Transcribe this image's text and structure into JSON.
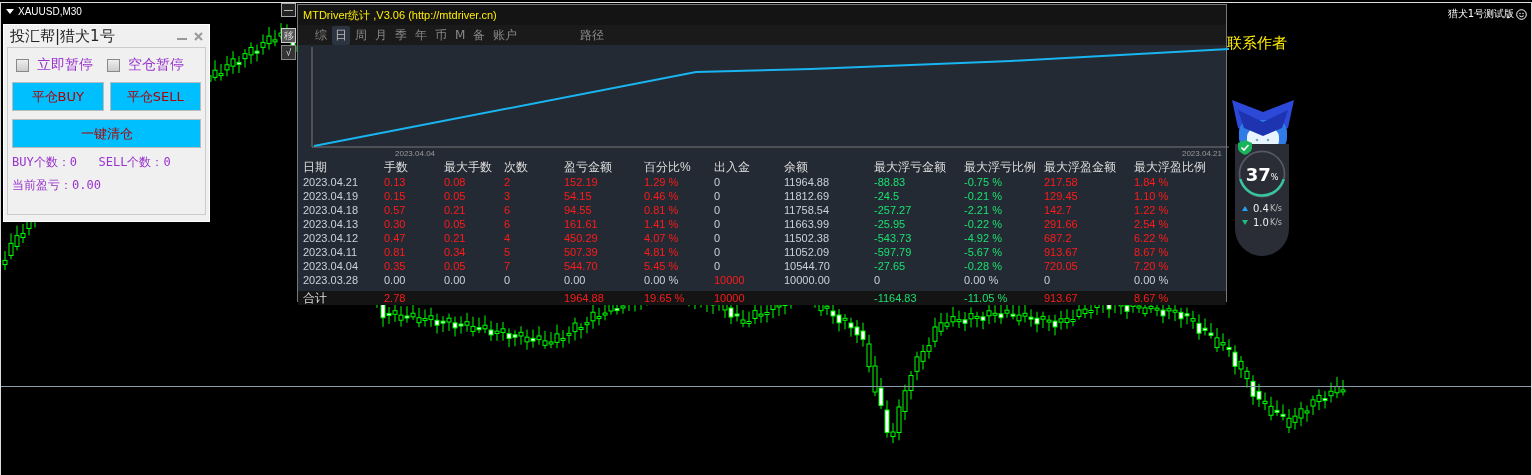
{
  "chart_window": {
    "symbol": "XAUUSD,M30",
    "edition": "猎犬1号测试版",
    "contact": "联系作者",
    "side_buttons": [
      "移",
      "√"
    ],
    "minimize": "—"
  },
  "panel": {
    "title": "投汇帮|猎犬1号",
    "checkboxes": [
      {
        "label": "立即暂停",
        "checked": false
      },
      {
        "label": "空仓暂停",
        "checked": false
      }
    ],
    "buttons": [
      "平仓BUY",
      "平仓SELL"
    ],
    "wide_button": "一键清仓",
    "counts": "BUY个数：0   SELL个数：0",
    "profit": "当前盈亏：0.00"
  },
  "stats": {
    "title": "MTDriver统计 ,V3.06 (http://mtdriver.cn)",
    "tabs": [
      {
        "label": "综",
        "selected": false
      },
      {
        "label": "日",
        "selected": true
      },
      {
        "label": "周",
        "selected": false
      },
      {
        "label": "月",
        "selected": false
      },
      {
        "label": "季",
        "selected": false
      },
      {
        "label": "年",
        "selected": false
      },
      {
        "label": "币",
        "selected": false
      },
      {
        "label": "M",
        "selected": false
      },
      {
        "label": "备",
        "selected": false
      },
      {
        "label": "账户",
        "selected": false
      },
      {
        "label": "路径",
        "selected": false
      }
    ],
    "chart_start": "2023.04.04",
    "chart_end": "2023.04.21",
    "columns": [
      "日期",
      "手数",
      "最大手数",
      "次数",
      "盈亏金额",
      "百分比%",
      "出入金",
      "余额",
      "最大浮亏金额",
      "最大浮亏比例",
      "最大浮盈金额",
      "最大浮盈比例"
    ],
    "rows": [
      {
        "kind": "trade",
        "cells": [
          "2023.04.21",
          "0.13",
          "0.08",
          "2",
          "152.19",
          "1.29 %",
          "0",
          "11964.88",
          "-88.83",
          "-0.75 %",
          "217.58",
          "1.84 %"
        ]
      },
      {
        "kind": "trade",
        "cells": [
          "2023.04.19",
          "0.15",
          "0.05",
          "3",
          "54.15",
          "0.46 %",
          "0",
          "11812.69",
          "-24.5",
          "-0.21 %",
          "129.45",
          "1.10 %"
        ]
      },
      {
        "kind": "trade",
        "cells": [
          "2023.04.18",
          "0.57",
          "0.21",
          "6",
          "94.55",
          "0.81 %",
          "0",
          "11758.54",
          "-257.27",
          "-2.21 %",
          "142.7",
          "1.22 %"
        ]
      },
      {
        "kind": "trade",
        "cells": [
          "2023.04.13",
          "0.30",
          "0.05",
          "6",
          "161.61",
          "1.41 %",
          "0",
          "11663.99",
          "-25.95",
          "-0.22 %",
          "291.66",
          "2.54 %"
        ]
      },
      {
        "kind": "trade",
        "cells": [
          "2023.04.12",
          "0.47",
          "0.21",
          "4",
          "450.29",
          "4.07 %",
          "0",
          "11502.38",
          "-543.73",
          "-4.92 %",
          "687.2",
          "6.22 %"
        ]
      },
      {
        "kind": "trade",
        "cells": [
          "2023.04.11",
          "0.81",
          "0.34",
          "5",
          "507.39",
          "4.81 %",
          "0",
          "11052.09",
          "-597.79",
          "-5.67 %",
          "913.67",
          "8.67 %"
        ]
      },
      {
        "kind": "trade",
        "cells": [
          "2023.04.04",
          "0.35",
          "0.05",
          "7",
          "544.70",
          "5.45 %",
          "0",
          "10544.70",
          "-27.65",
          "-0.28 %",
          "720.05",
          "7.20 %"
        ]
      },
      {
        "kind": "deposit",
        "cells": [
          "2023.03.28",
          "0.00",
          "0.00",
          "0",
          "0.00",
          "0.00 %",
          "10000",
          "10000.00",
          "0",
          "0.00 %",
          "0",
          "0.00 %"
        ]
      },
      {
        "kind": "total",
        "cells": [
          "合计",
          "2.78",
          null,
          null,
          "1964.88",
          "19.65 %",
          "10000",
          null,
          "-1164.83",
          "-11.05 %",
          "913.67",
          "8.67 %"
        ]
      }
    ]
  },
  "monitor": {
    "percent": "37",
    "unit": "%",
    "upload": "0.4",
    "upload_unit": "K/s",
    "download": "1.0",
    "download_unit": "K/s"
  }
}
